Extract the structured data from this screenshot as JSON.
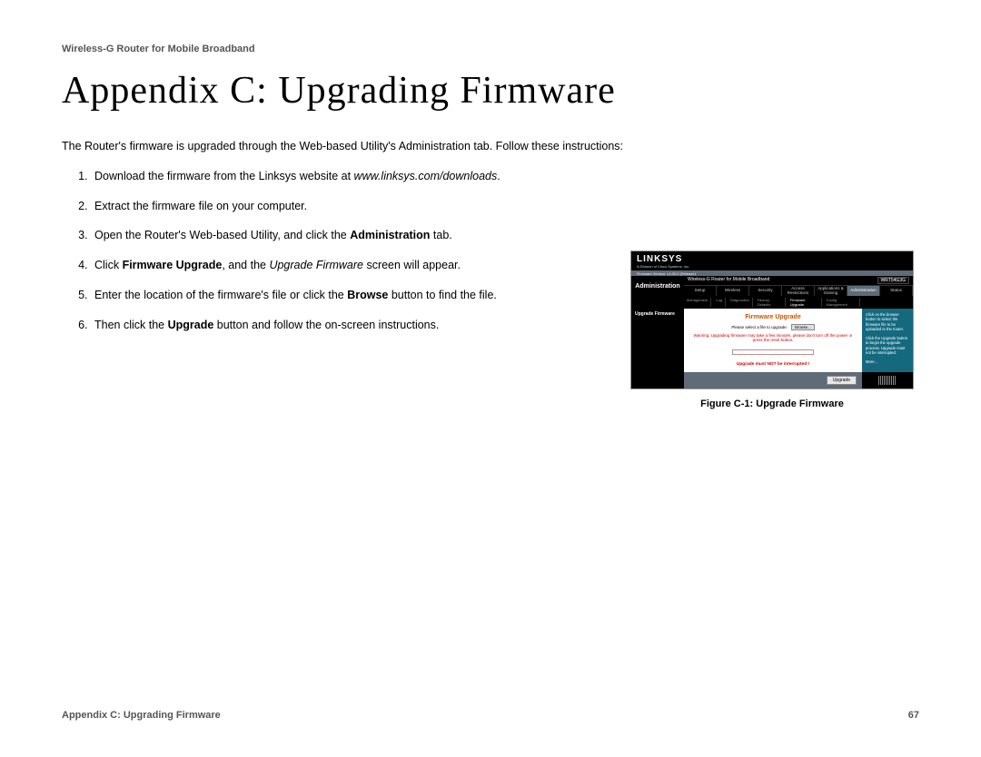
{
  "header": "Wireless-G Router for Mobile Broadband",
  "title": "Appendix C: Upgrading Firmware",
  "intro": "The Router's firmware is upgraded through the Web-based Utility's Administration tab. Follow these instructions:",
  "steps": {
    "s1a": "Download the firmware from the Linksys website at ",
    "s1b": "www.linksys.com/downloads",
    "s1c": ".",
    "s2": "Extract the firmware file on your computer.",
    "s3a": "Open the Router's Web-based Utility, and click the ",
    "s3b": "Administration",
    "s3c": " tab.",
    "s4a": "Click ",
    "s4b": "Firmware Upgrade",
    "s4c": ", and the ",
    "s4d": "Upgrade Firmware",
    "s4e": " screen will appear.",
    "s5a": "Enter the location of the firmware's file or click the ",
    "s5b": "Browse",
    "s5c": " button to find the file.",
    "s6a": "Then click the ",
    "s6b": "Upgrade",
    "s6c": " button and follow the on-screen instructions."
  },
  "figure": {
    "caption": "Figure C-1: Upgrade Firmware",
    "logo": "LINKSYS",
    "logo_sub": "A Division of Cisco Systems, Inc.",
    "bar_left": "Firmware Version: v1.00.0 (Release)",
    "nav_title": "Wireless-G Router for Mobile Broadband",
    "model": "WRT54G3G",
    "nav_left": "Administration",
    "tabs": [
      "Setup",
      "Wireless",
      "Security",
      "Access\nRestrictions",
      "Applications\n& Gaming",
      "Administration",
      "Status"
    ],
    "subtabs": [
      "Management",
      "Log",
      "Diagnostics",
      "Factory Defaults",
      "Firmware Upgrade",
      "Config Management"
    ],
    "body_left": "Upgrade Firmware",
    "body_title": "Firmware Upgrade",
    "body_row": "Please select a file to upgrade:",
    "browse": "Browse...",
    "warn": "Warning: Upgrading firmware may take a few minutes, please don't turn off the power or press the reset button.",
    "interrupt": "Upgrade must NOT be interrupted !",
    "help1": "Click on the browse button to select the firmware file to be uploaded to the router.",
    "help2": "Click the Upgrade button to begin the upgrade process. Upgrade must not be interrupted.",
    "help3": "More...",
    "upgrade": "Upgrade"
  },
  "footer": {
    "left": "Appendix C: Upgrading Firmware",
    "right": "67"
  }
}
